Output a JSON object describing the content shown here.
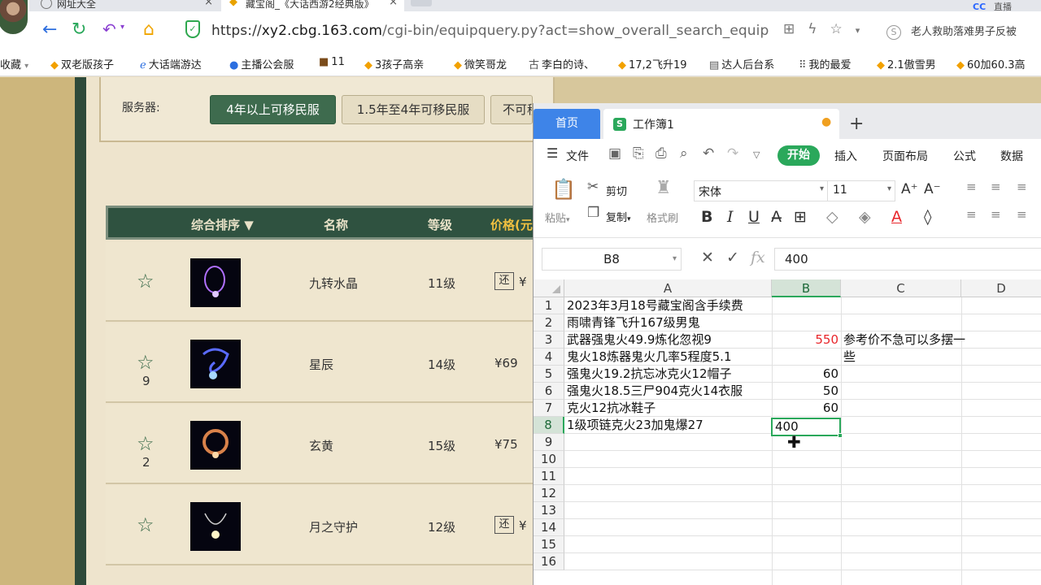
{
  "browser": {
    "tabs": [
      {
        "label": "网址大全"
      },
      {
        "label": "藏宝阁_《大话西游2经典版》"
      }
    ],
    "tab_right_logo": "CC",
    "tab_right_text": "直播",
    "url_scheme": "https://",
    "url_host": "xy2.cbg.163.com",
    "url_path": "/cgi-bin/equipquery.py?act=show_overall_search_equip",
    "search_hint": "老人救助落难男子反被",
    "search_logo": "S",
    "bookmarks": [
      "收藏",
      "双老版孩子",
      "大话端游达",
      "主播公会服",
      "11",
      "3孩子高亲",
      "微笑哥龙",
      "李白的诗、",
      "17,2飞升19",
      "达人后台系",
      "我的最爱",
      "2.1傲雪男",
      "60加60.3高"
    ]
  },
  "page": {
    "server_label": "服务器:",
    "server_buttons": [
      "4年以上可移民服",
      "1.5年至4年可移民服",
      "不可移民服"
    ],
    "table_headers": {
      "sort": "综合排序",
      "name": "名称",
      "level": "等级",
      "price": "价格(元)"
    },
    "rows": [
      {
        "name": "九转水晶",
        "level": "11级",
        "star_count": "",
        "price": "¥",
        "huan": "还"
      },
      {
        "name": "星辰",
        "level": "14级",
        "star_count": "9",
        "price": "¥69",
        "huan": ""
      },
      {
        "name": "玄黄",
        "level": "15级",
        "star_count": "2",
        "price": "¥75",
        "huan": ""
      },
      {
        "name": "月之守护",
        "level": "12级",
        "star_count": "",
        "price": "¥",
        "huan": "还"
      }
    ]
  },
  "wps": {
    "home_tab": "首页",
    "book_icon": "S",
    "book_name": "工作簿1",
    "menu": {
      "file": "文件",
      "start": "开始",
      "insert": "插入",
      "layout": "页面布局",
      "formula": "公式",
      "data": "数据"
    },
    "ribbon": {
      "cut": "剪切",
      "paste": "粘贴",
      "copy": "复制",
      "format_painter": "格式刷",
      "font": "宋体",
      "size": "11"
    },
    "namebox": "B8",
    "formula": "400",
    "columns": [
      "A",
      "B",
      "C",
      "D"
    ],
    "rows": [
      "1",
      "2",
      "3",
      "4",
      "5",
      "6",
      "7",
      "8",
      "9",
      "10",
      "11",
      "12",
      "13",
      "14",
      "15",
      "16"
    ],
    "cells": {
      "A1": "2023年3月18号藏宝阁含手续费",
      "A2": "雨啸青锋飞升167级男鬼",
      "A3": "武器强鬼火49.9炼化忽视9",
      "A4": "鬼火18炼器鬼火几率5程度5.1",
      "A5": "强鬼火19.2抗忘冰克火12帽子",
      "A6": "强鬼火18.5三尸904克火14衣服",
      "A7": "克火12抗冰鞋子",
      "A8": "1级项链克火23加鬼爆27",
      "B3": "550",
      "B5": "60",
      "B6": "50",
      "B7": "60",
      "B8": "400",
      "C3": "参考价不急可以多摆一些"
    },
    "colors": {
      "accent": "#2aa85b",
      "home_tab": "#3e84e8",
      "red_value": "#e8262b"
    }
  }
}
